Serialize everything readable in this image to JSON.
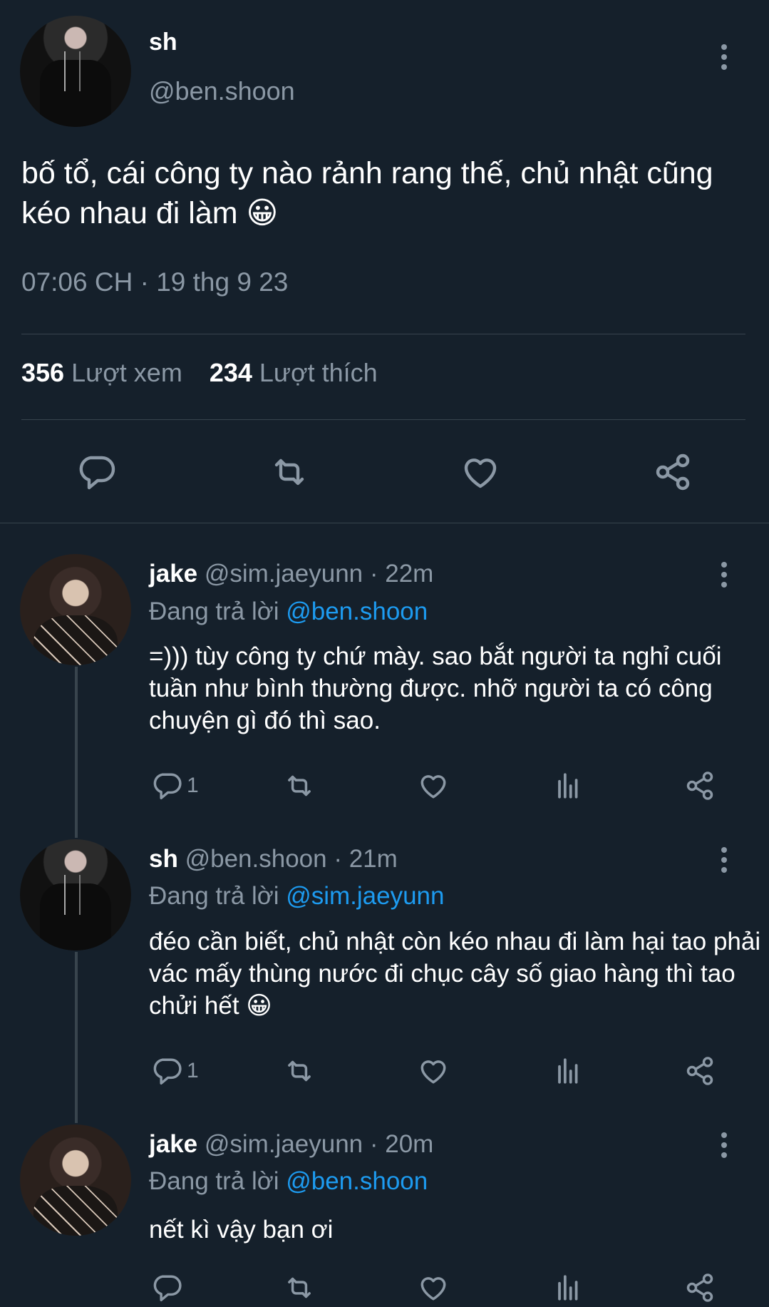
{
  "main_tweet": {
    "name": "sh",
    "handle": "@ben.shoon",
    "text": "bố tổ, cái công ty nào rảnh rang thế, chủ nhật cũng kéo nhau đi làm 😀",
    "time": "07:06 CH · 19 thg 9 23",
    "views_count": "356",
    "views_label": "Lượt xem",
    "likes_count": "234",
    "likes_label": "Lượt thích"
  },
  "replies": [
    {
      "name": "jake",
      "handle_time": "@sim.jaeyunn · 22m",
      "reply_prefix": "Đang trả lời",
      "reply_to": "@ben.shoon",
      "text": "=))) tùy công ty chứ mày. sao bắt người ta nghỉ cuối tuần như bình thường được. nhỡ người ta có công chuyện gì đó thì sao.",
      "reply_count": "1"
    },
    {
      "name": "sh",
      "handle_time": "@ben.shoon · 21m",
      "reply_prefix": "Đang trả lời",
      "reply_to": "@sim.jaeyunn",
      "text": "đéo cần biết, chủ nhật còn kéo nhau đi làm hại tao phải vác mấy thùng nước đi chục cây số giao hàng thì tao chửi hết 😀",
      "reply_count": "1"
    },
    {
      "name": "jake",
      "handle_time": "@sim.jaeyunn · 20m",
      "reply_prefix": "Đang trả lời",
      "reply_to": "@ben.shoon",
      "text": "nết kì vậy bạn ơi",
      "reply_count": ""
    }
  ],
  "icons": {
    "reply": "reply-icon",
    "retweet": "retweet-icon",
    "like": "heart-icon",
    "analytics": "analytics-icon",
    "share": "share-icon",
    "more": "more-vertical-icon"
  },
  "colors": {
    "background": "#15202b",
    "muted": "#8b98a5",
    "link": "#1d9bf0",
    "divider": "#38444d"
  }
}
